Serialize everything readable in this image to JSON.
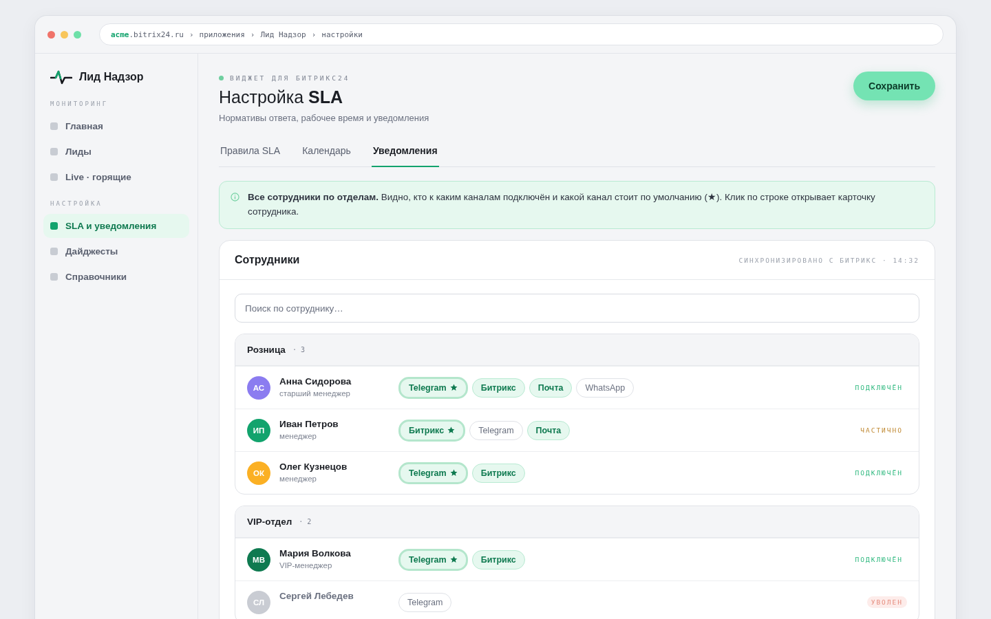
{
  "window": {
    "url": {
      "host": "acme",
      "domain": ".bitrix24.ru",
      "separator": "›",
      "crumbs": [
        "приложения",
        "Лид Надзор",
        "настройки"
      ]
    }
  },
  "sidebar": {
    "brand": "Лид Надзор",
    "sections": [
      {
        "title": "МОНИТОРИНГ",
        "items": [
          {
            "label": "Главная",
            "selected": false
          },
          {
            "label": "Лиды",
            "selected": false
          },
          {
            "label": "Live · горящие",
            "selected": false
          }
        ]
      },
      {
        "title": "НАСТРОЙКА",
        "items": [
          {
            "label": "SLA и уведомления",
            "selected": true
          },
          {
            "label": "Дайджесты",
            "selected": false
          },
          {
            "label": "Справочники",
            "selected": false
          }
        ]
      }
    ]
  },
  "header": {
    "eyebrow": "ВИДЖЕТ ДЛЯ БИТРИКС24",
    "title": "Настройка **SLA**",
    "subtitle": "Нормативы ответа, рабочее время и уведомления",
    "save_button": "Сохранить"
  },
  "tabs": [
    {
      "label": "Правила SLA",
      "selected": false
    },
    {
      "label": "Календарь",
      "selected": false
    },
    {
      "label": "Уведомления",
      "selected": true
    }
  ],
  "info": "**Все сотрудники по отделам.** Видно, кто к каким каналам подключён и какой канал стоит по умолчанию (★). Клик по строке открывает карточку сотрудника.",
  "employees_card": {
    "title": "Сотрудники",
    "sync": "СИНХРОНИЗИРОВАНО С БИТРИКС · 14:32",
    "search": {
      "placeholder": "Поиск по сотруднику…"
    },
    "groups": [
      {
        "name": "Розница",
        "count": "· 3",
        "members": [
          {
            "initials": "АС",
            "color": "#8b7cf0",
            "name": "Анна Сидорова",
            "role": "старший менеджер",
            "channels": [
              {
                "label": "Telegram",
                "connected": true,
                "default": true
              },
              {
                "label": "Битрикс",
                "connected": true,
                "default": false
              },
              {
                "label": "Почта",
                "connected": true,
                "default": false
              },
              {
                "label": "WhatsApp",
                "connected": false,
                "default": false
              }
            ],
            "status": {
              "label": "ПОДКЛЮЧЁН",
              "kind": "connected"
            }
          },
          {
            "initials": "ИП",
            "color": "#12a36d",
            "name": "Иван Петров",
            "role": "менеджер",
            "channels": [
              {
                "label": "Битрикс",
                "connected": true,
                "default": true
              },
              {
                "label": "Telegram",
                "connected": false,
                "default": false
              },
              {
                "label": "Почта",
                "connected": true,
                "default": false
              }
            ],
            "status": {
              "label": "ЧАСТИЧНО",
              "kind": "partial"
            }
          },
          {
            "initials": "ОК",
            "color": "#fbb024",
            "name": "Олег Кузнецов",
            "role": "менеджер",
            "channels": [
              {
                "label": "Telegram",
                "connected": true,
                "default": true
              },
              {
                "label": "Битрикс",
                "connected": true,
                "default": false
              }
            ],
            "status": {
              "label": "ПОДКЛЮЧЁН",
              "kind": "connected"
            }
          }
        ]
      },
      {
        "name": "VIP-отдел",
        "count": "· 2",
        "members": [
          {
            "initials": "МВ",
            "color": "#0f7a50",
            "name": "Мария Волкова",
            "role": "VIP-менеджер",
            "channels": [
              {
                "label": "Telegram",
                "connected": true,
                "default": true
              },
              {
                "label": "Битрикс",
                "connected": true,
                "default": false
              }
            ],
            "status": {
              "label": "ПОДКЛЮЧЁН",
              "kind": "connected"
            }
          },
          {
            "initials": "СЛ",
            "color": "#c9ccd3",
            "name": "Сергей Лебедев",
            "channels": [
              {
                "label": "Telegram",
                "connected": false,
                "default": false
              }
            ],
            "status": {
              "label": "УВОЛЕН",
              "kind": "fired"
            }
          }
        ]
      }
    ]
  }
}
